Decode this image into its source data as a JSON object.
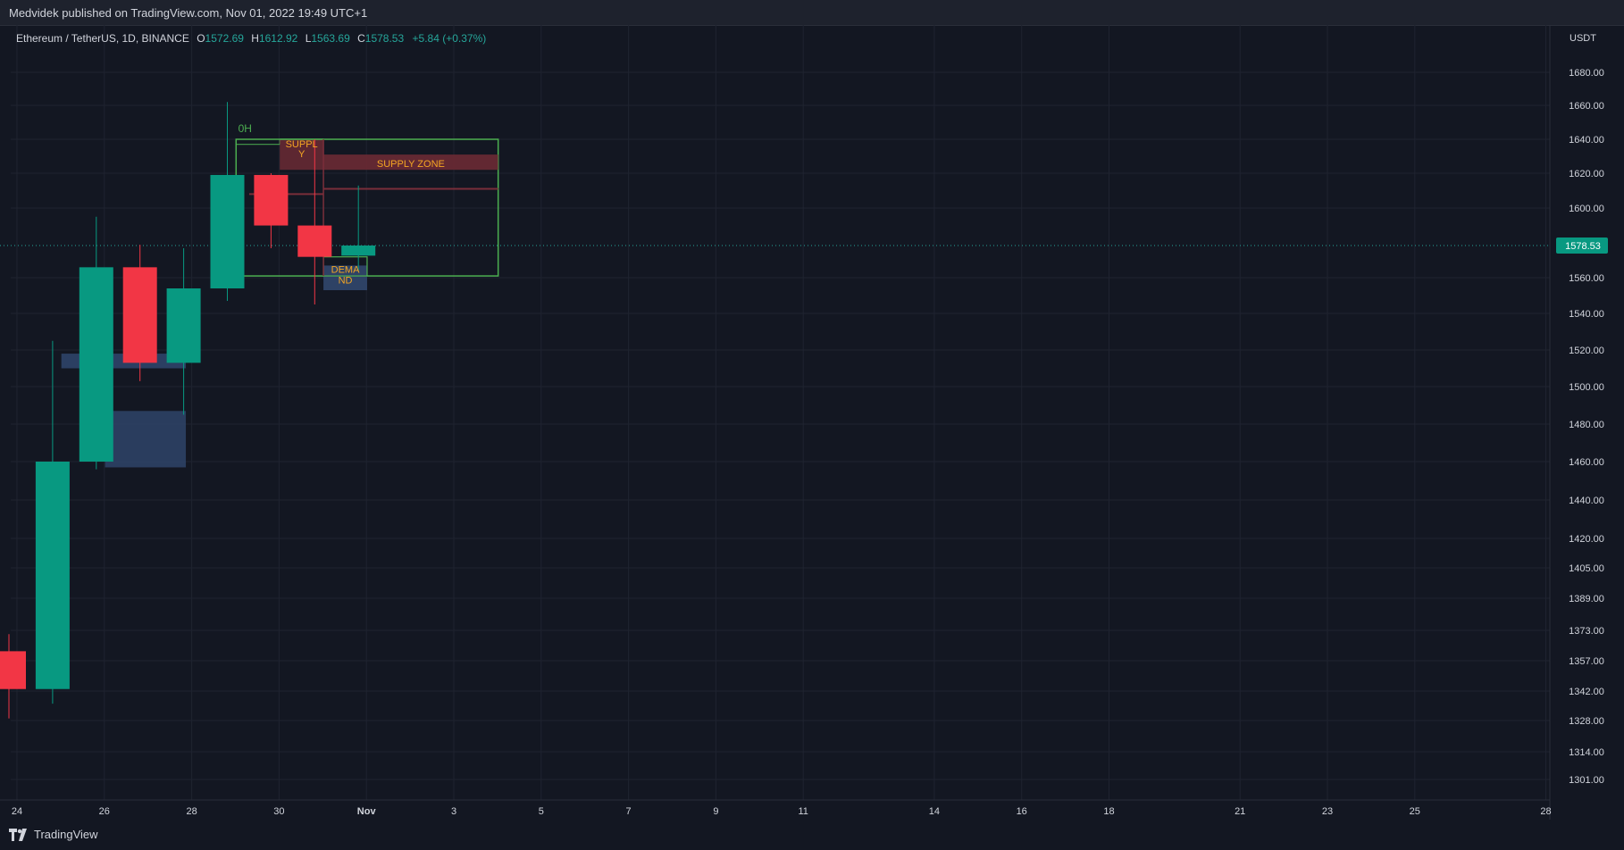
{
  "header": {
    "publish_note": "Medvidek published on TradingView.com, Nov 01, 2022 19:49 UTC+1"
  },
  "legend": {
    "symbol": "Ethereum / TetherUS, 1D, BINANCE",
    "o_label": "O",
    "o_value": "1572.69",
    "h_label": "H",
    "h_value": "1612.92",
    "l_label": "L",
    "l_value": "1563.69",
    "c_label": "C",
    "c_value": "1578.53",
    "change": "+5.84 (+0.37%)"
  },
  "footer": {
    "brand": "TradingView"
  },
  "colors": {
    "background": "#131722",
    "grid": "#1f2330",
    "up": "#089981",
    "down": "#f23645",
    "zone_green": "#4caf50",
    "supply_fill": "#6b2a34",
    "demand_fill": "#2f4469",
    "label_text": "#f5a623"
  },
  "chart_data": {
    "type": "candlestick",
    "currency": "USDT",
    "last_price": "1578.53",
    "y_ticks": [
      "1680.00",
      "1660.00",
      "1640.00",
      "1620.00",
      "1600.00",
      "1560.00",
      "1540.00",
      "1520.00",
      "1500.00",
      "1480.00",
      "1460.00",
      "1440.00",
      "1420.00",
      "1405.00",
      "1389.00",
      "1373.00",
      "1357.00",
      "1342.00",
      "1328.00",
      "1314.00",
      "1301.00"
    ],
    "x_ticks": [
      "24",
      "26",
      "28",
      "30",
      "Nov",
      "3",
      "5",
      "7",
      "9",
      "11",
      "14",
      "16",
      "18",
      "21",
      "23",
      "25",
      "28"
    ],
    "candles": [
      {
        "date": "2022-10-24",
        "o": 1362,
        "h": 1371,
        "l": 1329,
        "c": 1343
      },
      {
        "date": "2022-10-25",
        "o": 1343,
        "h": 1525,
        "l": 1336,
        "c": 1460
      },
      {
        "date": "2022-10-26",
        "o": 1460,
        "h": 1595,
        "l": 1456,
        "c": 1566
      },
      {
        "date": "2022-10-27",
        "o": 1566,
        "h": 1579,
        "l": 1503,
        "c": 1513
      },
      {
        "date": "2022-10-28",
        "o": 1513,
        "h": 1577,
        "l": 1485,
        "c": 1554
      },
      {
        "date": "2022-10-29",
        "o": 1554,
        "h": 1662,
        "l": 1547,
        "c": 1619
      },
      {
        "date": "2022-10-30",
        "o": 1619,
        "h": 1620,
        "l": 1577,
        "c": 1590
      },
      {
        "date": "2022-10-31",
        "o": 1590,
        "h": 1640,
        "l": 1545,
        "c": 1572
      },
      {
        "date": "2022-11-01",
        "o": 1572.69,
        "h": 1612.92,
        "l": 1563.69,
        "c": 1578.53
      }
    ],
    "annotations": {
      "supply_small": "SUPPLY",
      "supply_zone": "SUPPLY ZONE",
      "demand": "DEMAND",
      "marker": "0H"
    }
  }
}
